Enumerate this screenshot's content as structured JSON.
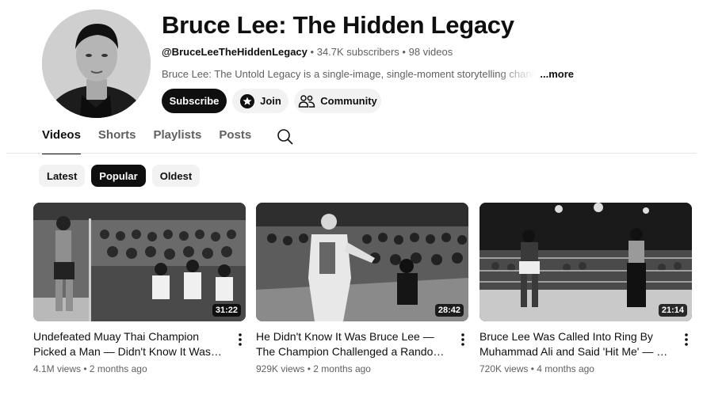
{
  "channel": {
    "title": "Bruce Lee: The Hidden Legacy",
    "handle": "@BruceLeeTheHiddenLegacy",
    "subscribers": "34.7K subscribers",
    "videos_count": "98 videos",
    "separator": "•",
    "description": "Bruce Lee: The Untold Legacy is a single-image, single-moment storytelling channel. Each",
    "more_label": "...more",
    "subscribe_label": "Subscribe",
    "join_label": "Join",
    "community_label": "Community"
  },
  "tabs": [
    "Videos",
    "Shorts",
    "Playlists",
    "Posts"
  ],
  "active_tab": "Videos",
  "icons": {
    "search": "search-icon",
    "join": "join-star-icon",
    "community": "community-people-icon",
    "more": "more-vert-icon"
  },
  "filters": [
    {
      "label": "Latest",
      "selected": false
    },
    {
      "label": "Popular",
      "selected": true
    },
    {
      "label": "Oldest",
      "selected": false
    }
  ],
  "videos": [
    {
      "title": "Undefeated Muay Thai Champion Picked a Man — Didn't Know It Was …",
      "views": "4.1M views",
      "age": "2 months ago",
      "duration": "31:22"
    },
    {
      "title": "He Didn't Know It Was Bruce Lee — The Champion Challenged a Random …",
      "views": "929K views",
      "age": "2 months ago",
      "duration": "28:42"
    },
    {
      "title": "Bruce Lee Was Called Into Ring By Muhammad Ali and Said 'Hit Me' — 3 …",
      "views": "720K views",
      "age": "4 months ago",
      "duration": "21:14"
    }
  ],
  "colors": {
    "text": "#0f0f0f",
    "secondary": "#606060",
    "chip_bg": "#f2f2f2",
    "accent_dark": "#0f0f0f"
  }
}
